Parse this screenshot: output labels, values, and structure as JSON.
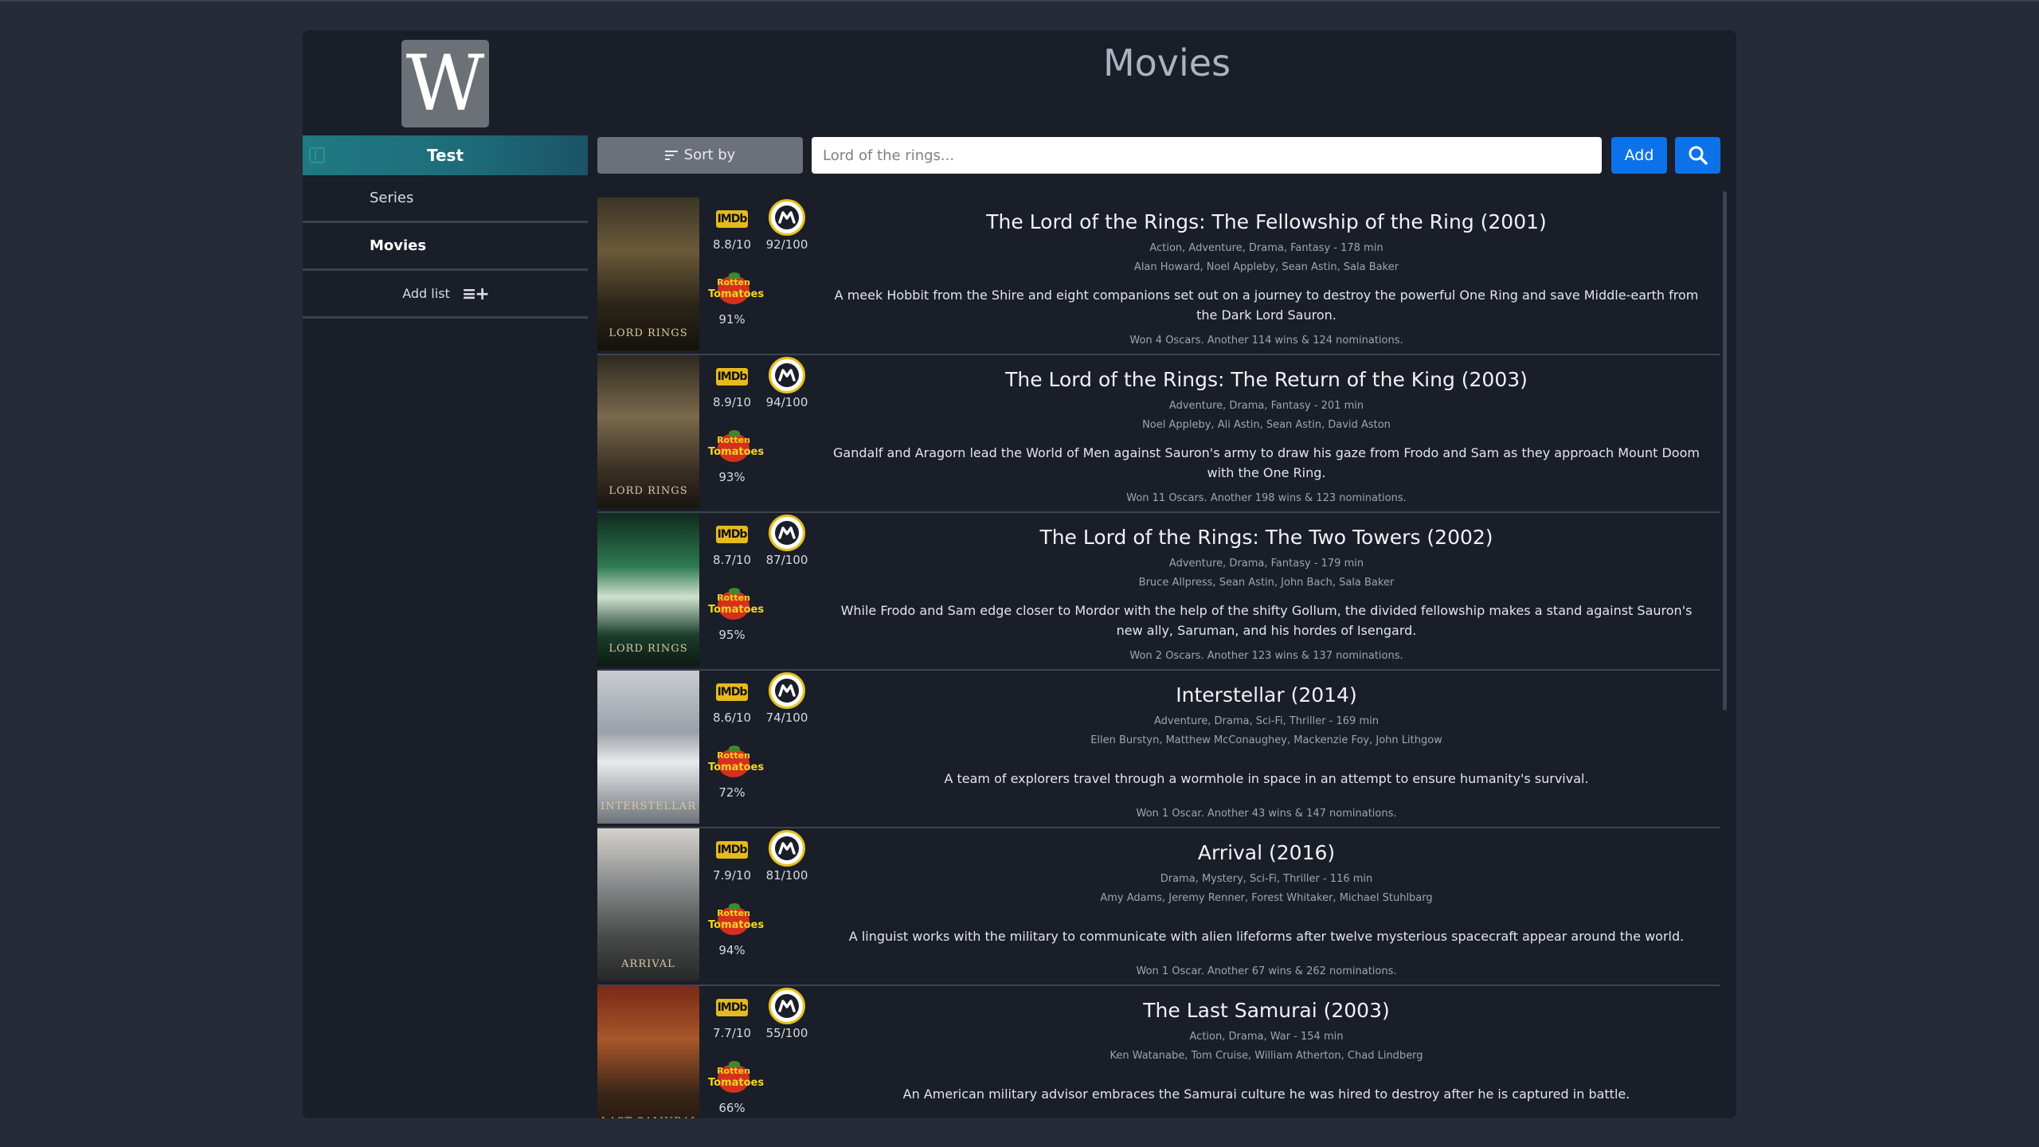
{
  "app": {
    "logo_letter": "W",
    "page_title": "Movies"
  },
  "sidebar": {
    "header": "Test",
    "items": [
      {
        "label": "Series",
        "active": false
      },
      {
        "label": "Movies",
        "active": true
      }
    ],
    "add_list_label": "Add list"
  },
  "toolbar": {
    "sort_label": "Sort by",
    "search_placeholder": "Lord of the rings...",
    "add_label": "Add",
    "search_icon": "search-icon"
  },
  "colors": {
    "accent": "#0d72ea",
    "sidebar_header": "#1f7a82",
    "imdb": "#e6b91e",
    "metacritic_ring": "#e5c11e",
    "rt": "#d4301d"
  },
  "movies": [
    {
      "title": "The Lord of the Rings: The Fellowship of the Ring (2001)",
      "genre": "Action, Adventure, Drama, Fantasy - 178 min",
      "cast": "Alan Howard, Noel Appleby, Sean Astin, Sala Baker",
      "plot": "A meek Hobbit from the Shire and eight companions set out on a journey to destroy the powerful One Ring and save Middle-earth from the Dark Lord Sauron.",
      "awards": "Won 4 Oscars. Another 114 wins & 124 nominations.",
      "imdb": "8.8/10",
      "metacritic": "92/100",
      "rotten": "91%",
      "poster_caption": "LORD RINGS"
    },
    {
      "title": "The Lord of the Rings: The Return of the King (2003)",
      "genre": "Adventure, Drama, Fantasy - 201 min",
      "cast": "Noel Appleby, Ali Astin, Sean Astin, David Aston",
      "plot": "Gandalf and Aragorn lead the World of Men against Sauron's army to draw his gaze from Frodo and Sam as they approach Mount Doom with the One Ring.",
      "awards": "Won 11 Oscars. Another 198 wins & 123 nominations.",
      "imdb": "8.9/10",
      "metacritic": "94/100",
      "rotten": "93%",
      "poster_caption": "LORD RINGS"
    },
    {
      "title": "The Lord of the Rings: The Two Towers (2002)",
      "genre": "Adventure, Drama, Fantasy - 179 min",
      "cast": "Bruce Allpress, Sean Astin, John Bach, Sala Baker",
      "plot": "While Frodo and Sam edge closer to Mordor with the help of the shifty Gollum, the divided fellowship makes a stand against Sauron's new ally, Saruman, and his hordes of Isengard.",
      "awards": "Won 2 Oscars. Another 123 wins & 137 nominations.",
      "imdb": "8.7/10",
      "metacritic": "87/100",
      "rotten": "95%",
      "poster_caption": "LORD RINGS"
    },
    {
      "title": "Interstellar (2014)",
      "genre": "Adventure, Drama, Sci-Fi, Thriller - 169 min",
      "cast": "Ellen Burstyn, Matthew McConaughey, Mackenzie Foy, John Lithgow",
      "plot": "A team of explorers travel through a wormhole in space in an attempt to ensure humanity's survival.",
      "awards": "Won 1 Oscar. Another 43 wins & 147 nominations.",
      "imdb": "8.6/10",
      "metacritic": "74/100",
      "rotten": "72%",
      "poster_caption": "INTERSTELLAR"
    },
    {
      "title": "Arrival (2016)",
      "genre": "Drama, Mystery, Sci-Fi, Thriller - 116 min",
      "cast": "Amy Adams, Jeremy Renner, Forest Whitaker, Michael Stuhlbarg",
      "plot": "A linguist works with the military to communicate with alien lifeforms after twelve mysterious spacecraft appear around the world.",
      "awards": "Won 1 Oscar. Another 67 wins & 262 nominations.",
      "imdb": "7.9/10",
      "metacritic": "81/100",
      "rotten": "94%",
      "poster_caption": "ARRIVAL"
    },
    {
      "title": "The Last Samurai (2003)",
      "genre": "Action, Drama, War - 154 min",
      "cast": "Ken Watanabe, Tom Cruise, William Atherton, Chad Lindberg",
      "plot": "An American military advisor embraces the Samurai culture he was hired to destroy after he is captured in battle.",
      "awards": "",
      "imdb": "7.7/10",
      "metacritic": "55/100",
      "rotten": "66%",
      "poster_caption": "LAST SAMURAI"
    }
  ],
  "ratings_labels": {
    "imdb_logo": "IMDb",
    "rt_line1": "Rotten",
    "rt_line2": "Tomatoes"
  }
}
